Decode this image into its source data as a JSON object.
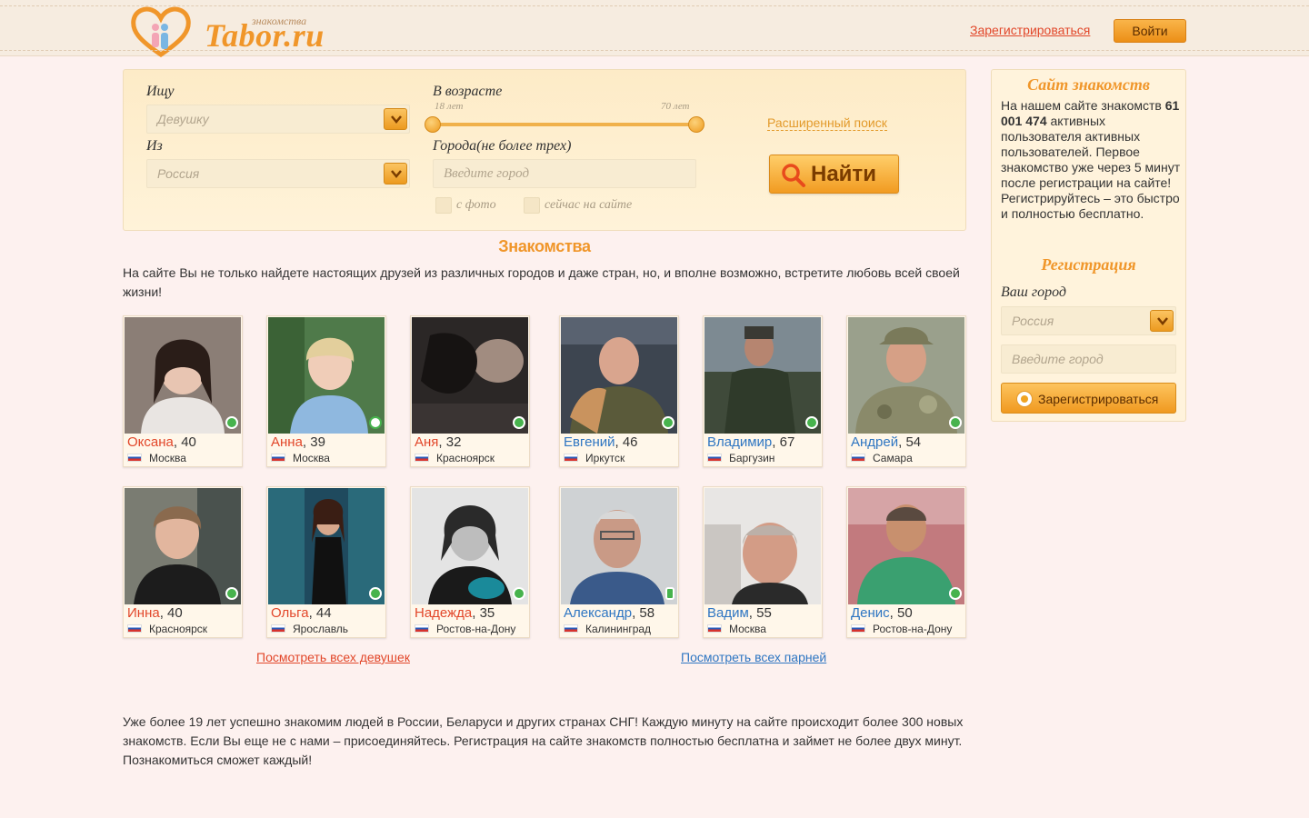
{
  "header": {
    "logo_sub": "знакомства",
    "logo_text": "Tabor.ru",
    "register_link": "Зарегистрироваться",
    "login_button": "Войти"
  },
  "search": {
    "seek_label": "Ищу",
    "seek_value": "Девушку",
    "from_label": "Из",
    "from_value": "Россия",
    "age_label": "В возрасте",
    "age_min": "18 лет",
    "age_max": "70 лет",
    "cities_label": "Города(не более трех)",
    "city_placeholder": "Введите город",
    "with_photo": "с фото",
    "online_now": "сейчас на сайте",
    "advanced": "Расширенный поиск",
    "find_button": "Найти"
  },
  "main": {
    "title": "Знакомства",
    "intro": "На сайте Вы не только найдете настоящих друзей из различных городов и даже стран, но, и вполне возможно, встретите любовь всей своей жизни!",
    "all_girls": "Посмотреть всех девушек",
    "all_boys": "Посмотреть всех парней",
    "outro": "Уже более 19 лет успешно знакомим людей в России, Беларуси и других странах СНГ! Каждую минуту на сайте происходит более 300 новых знакомств. Если Вы еще не с нами – присоединяйтесь. Регистрация на сайте знакомств полностью бесплатна и займет не более двух минут. Познакомиться сможет каждый!"
  },
  "profiles": [
    {
      "name": "Оксана",
      "age": ", 40",
      "city": "Москва",
      "gender": "f"
    },
    {
      "name": "Анна",
      "age": ", 39",
      "city": "Москва",
      "gender": "f"
    },
    {
      "name": "Аня",
      "age": ", 32",
      "city": "Красноярск",
      "gender": "f"
    },
    {
      "name": "Евгений",
      "age": ", 46",
      "city": "Иркутск",
      "gender": "m"
    },
    {
      "name": "Владимир",
      "age": ", 67",
      "city": "Баргузин",
      "gender": "m"
    },
    {
      "name": "Андрей",
      "age": ", 54",
      "city": "Самара",
      "gender": "m"
    },
    {
      "name": "Инна",
      "age": ", 40",
      "city": "Красноярск",
      "gender": "f"
    },
    {
      "name": "Ольга",
      "age": ", 44",
      "city": "Ярославль",
      "gender": "f"
    },
    {
      "name": "Надежда",
      "age": ", 35",
      "city": "Ростов-на-Дону",
      "gender": "f"
    },
    {
      "name": "Александр",
      "age": ", 58",
      "city": "Калининград",
      "gender": "m"
    },
    {
      "name": "Вадим",
      "age": ", 55",
      "city": "Москва",
      "gender": "m"
    },
    {
      "name": "Денис",
      "age": ", 50",
      "city": "Ростов-на-Дону",
      "gender": "m"
    }
  ],
  "sidebar": {
    "title": "Сайт знакомств",
    "text_before": "На нашем сайте знакомств ",
    "count": "61 001 474",
    "text_after": " активных пользователя активных пользователей. Первое знакомство уже через 5 минут после регистрации на сайте! Регистрируйтесь – это быстро и полностью бесплатно.",
    "reg_title": "Регистрация",
    "city_label": "Ваш город",
    "country_value": "Россия",
    "city_placeholder": "Введите город",
    "register_button": "Зарегистрироваться"
  },
  "colors": {
    "accent": "#f0962a",
    "female_link": "#e2472a",
    "male_link": "#2f76c2",
    "online": "#47b34d"
  }
}
